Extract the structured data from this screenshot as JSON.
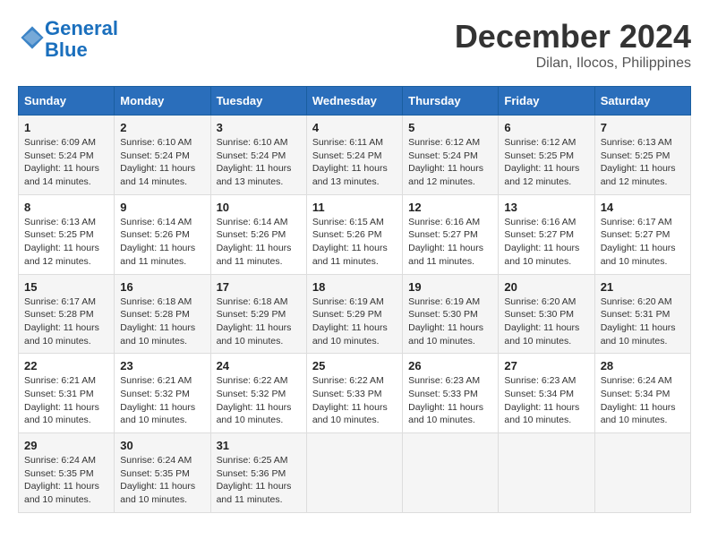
{
  "logo": {
    "line1": "General",
    "line2": "Blue"
  },
  "title": "December 2024",
  "location": "Dilan, Ilocos, Philippines",
  "days_of_week": [
    "Sunday",
    "Monday",
    "Tuesday",
    "Wednesday",
    "Thursday",
    "Friday",
    "Saturday"
  ],
  "weeks": [
    [
      {
        "day": 1,
        "info": "Sunrise: 6:09 AM\nSunset: 5:24 PM\nDaylight: 11 hours\nand 14 minutes."
      },
      {
        "day": 2,
        "info": "Sunrise: 6:10 AM\nSunset: 5:24 PM\nDaylight: 11 hours\nand 14 minutes."
      },
      {
        "day": 3,
        "info": "Sunrise: 6:10 AM\nSunset: 5:24 PM\nDaylight: 11 hours\nand 13 minutes."
      },
      {
        "day": 4,
        "info": "Sunrise: 6:11 AM\nSunset: 5:24 PM\nDaylight: 11 hours\nand 13 minutes."
      },
      {
        "day": 5,
        "info": "Sunrise: 6:12 AM\nSunset: 5:24 PM\nDaylight: 11 hours\nand 12 minutes."
      },
      {
        "day": 6,
        "info": "Sunrise: 6:12 AM\nSunset: 5:25 PM\nDaylight: 11 hours\nand 12 minutes."
      },
      {
        "day": 7,
        "info": "Sunrise: 6:13 AM\nSunset: 5:25 PM\nDaylight: 11 hours\nand 12 minutes."
      }
    ],
    [
      {
        "day": 8,
        "info": "Sunrise: 6:13 AM\nSunset: 5:25 PM\nDaylight: 11 hours\nand 12 minutes."
      },
      {
        "day": 9,
        "info": "Sunrise: 6:14 AM\nSunset: 5:26 PM\nDaylight: 11 hours\nand 11 minutes."
      },
      {
        "day": 10,
        "info": "Sunrise: 6:14 AM\nSunset: 5:26 PM\nDaylight: 11 hours\nand 11 minutes."
      },
      {
        "day": 11,
        "info": "Sunrise: 6:15 AM\nSunset: 5:26 PM\nDaylight: 11 hours\nand 11 minutes."
      },
      {
        "day": 12,
        "info": "Sunrise: 6:16 AM\nSunset: 5:27 PM\nDaylight: 11 hours\nand 11 minutes."
      },
      {
        "day": 13,
        "info": "Sunrise: 6:16 AM\nSunset: 5:27 PM\nDaylight: 11 hours\nand 10 minutes."
      },
      {
        "day": 14,
        "info": "Sunrise: 6:17 AM\nSunset: 5:27 PM\nDaylight: 11 hours\nand 10 minutes."
      }
    ],
    [
      {
        "day": 15,
        "info": "Sunrise: 6:17 AM\nSunset: 5:28 PM\nDaylight: 11 hours\nand 10 minutes."
      },
      {
        "day": 16,
        "info": "Sunrise: 6:18 AM\nSunset: 5:28 PM\nDaylight: 11 hours\nand 10 minutes."
      },
      {
        "day": 17,
        "info": "Sunrise: 6:18 AM\nSunset: 5:29 PM\nDaylight: 11 hours\nand 10 minutes."
      },
      {
        "day": 18,
        "info": "Sunrise: 6:19 AM\nSunset: 5:29 PM\nDaylight: 11 hours\nand 10 minutes."
      },
      {
        "day": 19,
        "info": "Sunrise: 6:19 AM\nSunset: 5:30 PM\nDaylight: 11 hours\nand 10 minutes."
      },
      {
        "day": 20,
        "info": "Sunrise: 6:20 AM\nSunset: 5:30 PM\nDaylight: 11 hours\nand 10 minutes."
      },
      {
        "day": 21,
        "info": "Sunrise: 6:20 AM\nSunset: 5:31 PM\nDaylight: 11 hours\nand 10 minutes."
      }
    ],
    [
      {
        "day": 22,
        "info": "Sunrise: 6:21 AM\nSunset: 5:31 PM\nDaylight: 11 hours\nand 10 minutes."
      },
      {
        "day": 23,
        "info": "Sunrise: 6:21 AM\nSunset: 5:32 PM\nDaylight: 11 hours\nand 10 minutes."
      },
      {
        "day": 24,
        "info": "Sunrise: 6:22 AM\nSunset: 5:32 PM\nDaylight: 11 hours\nand 10 minutes."
      },
      {
        "day": 25,
        "info": "Sunrise: 6:22 AM\nSunset: 5:33 PM\nDaylight: 11 hours\nand 10 minutes."
      },
      {
        "day": 26,
        "info": "Sunrise: 6:23 AM\nSunset: 5:33 PM\nDaylight: 11 hours\nand 10 minutes."
      },
      {
        "day": 27,
        "info": "Sunrise: 6:23 AM\nSunset: 5:34 PM\nDaylight: 11 hours\nand 10 minutes."
      },
      {
        "day": 28,
        "info": "Sunrise: 6:24 AM\nSunset: 5:34 PM\nDaylight: 11 hours\nand 10 minutes."
      }
    ],
    [
      {
        "day": 29,
        "info": "Sunrise: 6:24 AM\nSunset: 5:35 PM\nDaylight: 11 hours\nand 10 minutes."
      },
      {
        "day": 30,
        "info": "Sunrise: 6:24 AM\nSunset: 5:35 PM\nDaylight: 11 hours\nand 10 minutes."
      },
      {
        "day": 31,
        "info": "Sunrise: 6:25 AM\nSunset: 5:36 PM\nDaylight: 11 hours\nand 11 minutes."
      },
      null,
      null,
      null,
      null
    ]
  ]
}
